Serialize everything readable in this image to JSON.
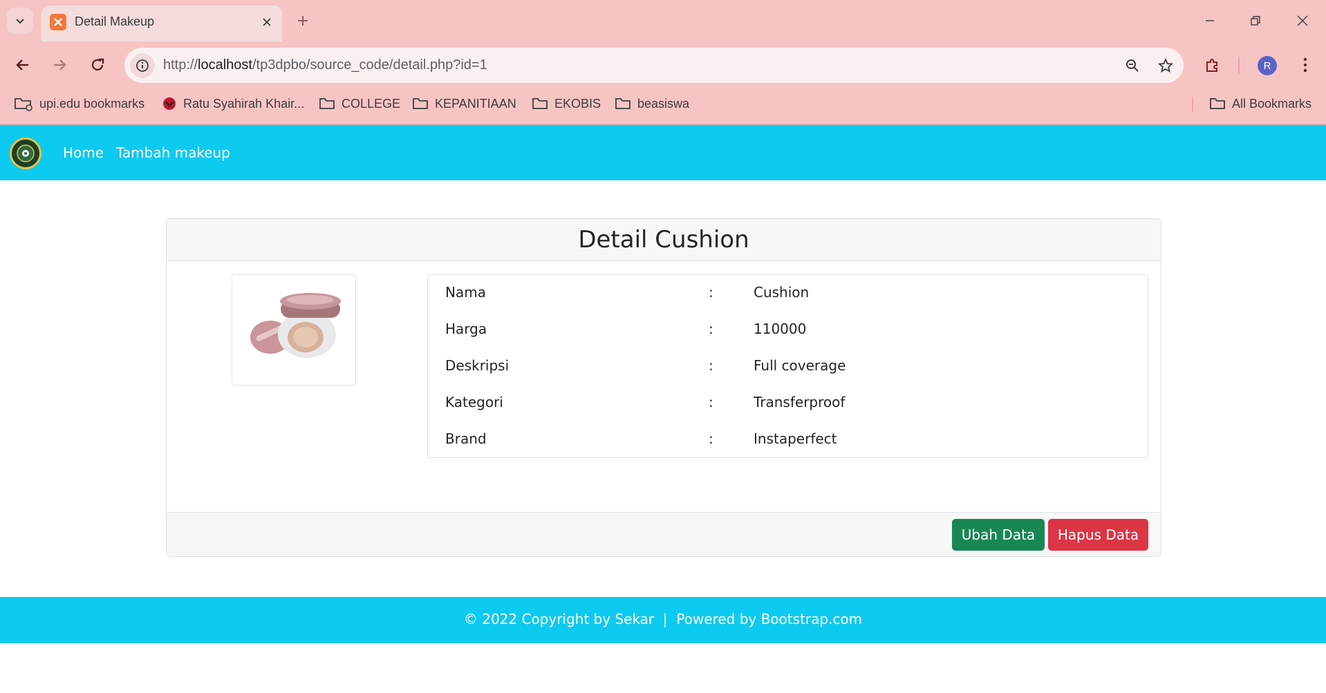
{
  "browser": {
    "tab": {
      "title": "Detail Makeup",
      "favicon": "xampp-icon"
    },
    "url": {
      "scheme": "http://",
      "host": "localhost",
      "path": "/tp3dpbo/source_code/detail.php?id=1"
    },
    "profile_initial": "R",
    "bookmarks": [
      {
        "label": "upi.edu bookmarks",
        "icon": "managed-folder-icon"
      },
      {
        "label": "Ratu Syahirah Khair...",
        "icon": "site-favicon"
      },
      {
        "label": "COLLEGE",
        "icon": "folder-icon"
      },
      {
        "label": "KEPANITIAAN",
        "icon": "folder-icon"
      },
      {
        "label": "EKOBIS",
        "icon": "folder-icon"
      },
      {
        "label": "beasiswa",
        "icon": "folder-icon"
      }
    ],
    "all_bookmarks": "All Bookmarks"
  },
  "navbar": {
    "links": [
      "Home",
      "Tambah makeup"
    ]
  },
  "card": {
    "title": "Detail Cushion",
    "rows": [
      {
        "label": "Nama",
        "sep": ":",
        "value": "Cushion"
      },
      {
        "label": "Harga",
        "sep": ":",
        "value": "110000"
      },
      {
        "label": "Deskripsi",
        "sep": ":",
        "value": "Full coverage"
      },
      {
        "label": "Kategori",
        "sep": ":",
        "value": "Transferproof"
      },
      {
        "label": "Brand",
        "sep": ":",
        "value": "Instaperfect"
      }
    ],
    "buttons": {
      "edit": "Ubah Data",
      "delete": "Hapus Data"
    }
  },
  "footer": {
    "text": "© 2022 Copyright by Sekar  |  Powered by Bootstrap.com"
  },
  "colors": {
    "chrome_bg": "#f7c4c4",
    "navbar": "#0dcaf0",
    "btn_edit": "#198754",
    "btn_delete": "#dc3545"
  }
}
